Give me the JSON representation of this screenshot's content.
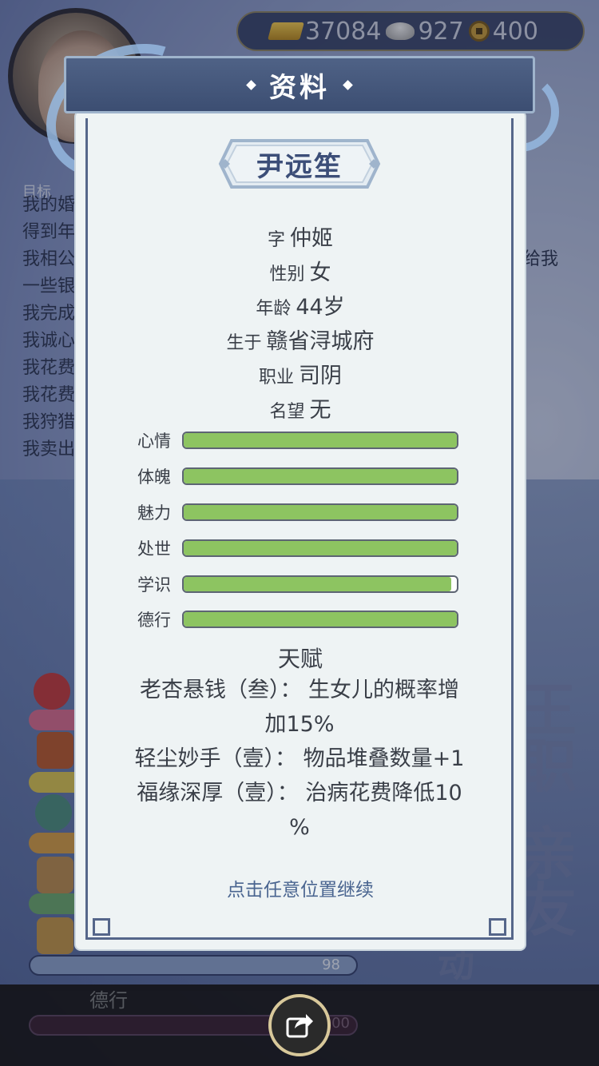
{
  "top_bar": {
    "gold_ingot": "37084",
    "silver_ingot": "927",
    "copper_coin": "400"
  },
  "background": {
    "goal_label": "目标",
    "log_lines": [
      "我的婚",
      "得到年",
      "我相公",
      "一些银",
      "我完成",
      "我诚心",
      "我花费",
      "我花费",
      "我狩猎",
      "我卖出"
    ],
    "log_right": "给我",
    "stat_value": "98",
    "bottom_label": "德行",
    "bottom_value": "00",
    "side_chars": [
      "王",
      "职",
      "亲",
      "友",
      "动"
    ]
  },
  "modal": {
    "title": "资料",
    "name": "尹远笙",
    "info": [
      {
        "key": "字",
        "value": "仲姬"
      },
      {
        "key": "性别",
        "value": "女"
      },
      {
        "key": "年龄",
        "value": "44岁"
      },
      {
        "key": "生于",
        "value": "赣省浔城府"
      },
      {
        "key": "职业",
        "value": "司阴"
      },
      {
        "key": "名望",
        "value": "无"
      }
    ],
    "stats": [
      {
        "label": "心情",
        "fill": 1.0
      },
      {
        "label": "体魄",
        "fill": 1.0
      },
      {
        "label": "魅力",
        "fill": 1.0
      },
      {
        "label": "处世",
        "fill": 1.0
      },
      {
        "label": "学识",
        "fill": 0.98
      },
      {
        "label": "德行",
        "fill": 1.0
      }
    ],
    "talent_title": "天赋",
    "talent_lines": [
      "老杏悬钱（叁）： 生女儿的概率增",
      "加15%",
      "轻尘妙手（壹）： 物品堆叠数量+1",
      "福缘深厚（壹）： 治病花费降低10",
      "%"
    ],
    "continue_hint": "点击任意位置继续"
  },
  "colors": {
    "header_bg": "#4a5c80",
    "stat_fill": "#8dc461",
    "panel_bg": "#eef3f4",
    "name_color": "#3c4e78",
    "hint_color": "#4a6590"
  }
}
